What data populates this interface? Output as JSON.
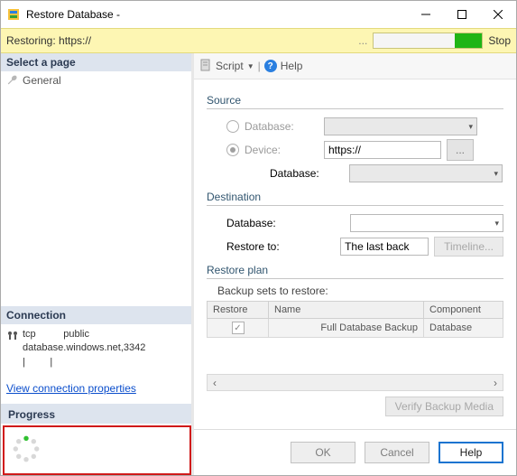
{
  "window": {
    "title": "Restore Database -"
  },
  "restoring": {
    "label": "Restoring: https://",
    "stop": "Stop"
  },
  "left": {
    "select_page_hdr": "Select a page",
    "pages": [
      {
        "label": "General"
      }
    ],
    "connection_hdr": "Connection",
    "connection_host": "tcp",
    "connection_user": "public",
    "connection_server": "database.windows.net,3342",
    "view_props": "View connection properties",
    "progress_hdr": "Progress"
  },
  "toolbar": {
    "script": "Script",
    "help": "Help"
  },
  "source": {
    "title": "Source",
    "database_lbl": "Database:",
    "device_lbl": "Device:",
    "device_value": "https://",
    "dots": "...",
    "db2_lbl": "Database:"
  },
  "dest": {
    "title": "Destination",
    "database_lbl": "Database:",
    "restore_to_lbl": "Restore to:",
    "restore_to_value": "The last back",
    "timeline_btn": "Timeline..."
  },
  "plan": {
    "title": "Restore plan",
    "subtitle": "Backup sets to restore:",
    "cols": {
      "restore": "Restore",
      "name": "Name",
      "component": "Component"
    },
    "rows": [
      {
        "checked": true,
        "name": "Full Database Backup",
        "component": "Database"
      }
    ],
    "verify_btn": "Verify Backup Media"
  },
  "footer": {
    "ok": "OK",
    "cancel": "Cancel",
    "help": "Help"
  }
}
